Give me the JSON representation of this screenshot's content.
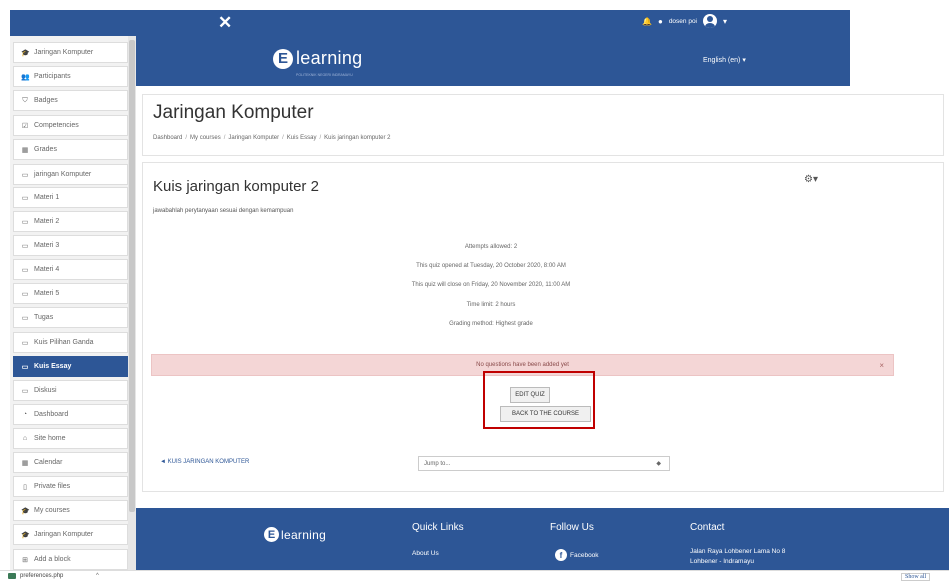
{
  "topbar": {
    "close_glyph": "✕",
    "bell_icon": "🔔",
    "chat_icon": "●",
    "username": "dosen poi",
    "caret": "▾"
  },
  "sidebar": {
    "items": [
      {
        "icon": "🎓",
        "label": "Jaringan Komputer"
      },
      {
        "icon": "👥",
        "label": "Participants"
      },
      {
        "icon": "⛉",
        "label": "Badges"
      },
      {
        "icon": "☑",
        "label": "Competencies"
      },
      {
        "icon": "▦",
        "label": "Grades"
      },
      {
        "icon": "▭",
        "label": "jaringan Komputer"
      },
      {
        "icon": "▭",
        "label": "Materi 1"
      },
      {
        "icon": "▭",
        "label": "Materi 2"
      },
      {
        "icon": "▭",
        "label": "Materi 3"
      },
      {
        "icon": "▭",
        "label": "Materi 4"
      },
      {
        "icon": "▭",
        "label": "Materi 5"
      },
      {
        "icon": "▭",
        "label": "Tugas"
      },
      {
        "icon": "▭",
        "label": "Kuis Pilihan Ganda"
      },
      {
        "icon": "▭",
        "label": "Kuis Essay"
      },
      {
        "icon": "▭",
        "label": "Diskusi"
      },
      {
        "icon": "◔",
        "label": "Dashboard"
      },
      {
        "icon": "⌂",
        "label": "Site home"
      },
      {
        "icon": "▦",
        "label": "Calendar"
      },
      {
        "icon": "▯",
        "label": "Private files"
      },
      {
        "icon": "🎓",
        "label": "My courses"
      },
      {
        "icon": "🎓",
        "label": "Jaringan Komputer"
      },
      {
        "icon": "⊞",
        "label": "Add a block"
      }
    ],
    "active_index": 13
  },
  "header": {
    "logo_letter": "E",
    "logo_text": "learning",
    "logo_tagline": "POLITEKNIK NEGERI INDRAMAYU",
    "language": "English (en)",
    "language_caret": "▾"
  },
  "course": {
    "title": "Jaringan Komputer",
    "breadcrumb": [
      "Dashboard",
      "My courses",
      "Jaringan Komputer",
      "Kuis Essay",
      "Kuis jaringan komputer 2"
    ],
    "separator": "/"
  },
  "quiz": {
    "title": "Kuis jaringan komputer 2",
    "gear_glyph": "⚙",
    "gear_caret": "▾",
    "description": "jawabahlah perytanyaan sesuai dengan kemampuan",
    "attempts": "Attempts allowed: 2",
    "opened": "This quiz opened at Tuesday, 20 October 2020, 8:00 AM",
    "closes": "This quiz will close on Friday, 20 November 2020, 11:00 AM",
    "time_limit": "Time limit: 2 hours",
    "grading": "Grading method: Highest grade",
    "alert": "No questions have been added yet",
    "alert_close": "×",
    "edit_button": "EDIT QUIZ",
    "back_button": "BACK TO THE COURSE",
    "prev_link": "◄ KUIS JARINGAN KOMPUTER",
    "jump_placeholder": "Jump to...",
    "jump_caret": "◆"
  },
  "footer": {
    "logo_letter": "E",
    "logo_text": "learning",
    "quick_links_heading": "Quick Links",
    "about_link": "About Us",
    "follow_heading": "Follow Us",
    "facebook_letter": "f",
    "facebook_label": "Facebook",
    "contact_heading": "Contact",
    "address_line1": "Jalan Raya Lohbener Lama No 8",
    "address_line2": "Lohbener - Indramayu"
  },
  "download_bar": {
    "file_name": "preferences.php",
    "caret": "^",
    "show_all": "Show all"
  }
}
